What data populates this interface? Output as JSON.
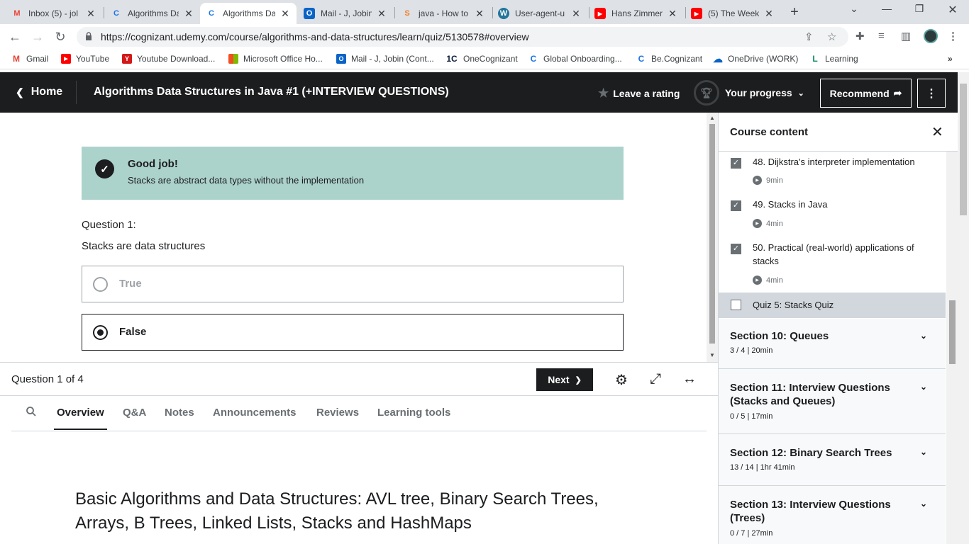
{
  "browser": {
    "tabs": [
      {
        "title": "Inbox (5) - jol",
        "icon": "gmail-icon",
        "color": "#ea4335",
        "glyph": "M"
      },
      {
        "title": "Algorithms Da",
        "icon": "cognizant-icon",
        "color": "#1a73e8",
        "glyph": "C"
      },
      {
        "title": "Algorithms Da",
        "icon": "cognizant-icon",
        "color": "#1a73e8",
        "glyph": "C"
      },
      {
        "title": "Mail - J, Jobin",
        "icon": "outlook-icon",
        "color": "#0a64c8",
        "glyph": "O"
      },
      {
        "title": "java - How to",
        "icon": "stackoverflow-icon",
        "color": "#f48024",
        "glyph": "S"
      },
      {
        "title": "User-agent-u",
        "icon": "wordpress-icon",
        "color": "#21759b",
        "glyph": "W"
      },
      {
        "title": "Hans Zimmer",
        "icon": "youtube-icon",
        "color": "#ff0000",
        "glyph": "▶"
      },
      {
        "title": "(5) The Week",
        "icon": "youtube-icon",
        "color": "#ff0000",
        "glyph": "▶"
      }
    ],
    "url": "https://cognizant.udemy.com/course/algorithms-and-data-structures/learn/quiz/5130578#overview",
    "bookmarks": [
      {
        "label": "Gmail",
        "color": "#ea4335",
        "glyph": "M"
      },
      {
        "label": "YouTube",
        "color": "#ff0000",
        "glyph": "▶"
      },
      {
        "label": "Youtube Download...",
        "color": "#d21919",
        "glyph": "Y"
      },
      {
        "label": "Microsoft Office Ho...",
        "color": "#f25022",
        "glyph": "■"
      },
      {
        "label": "Mail - J, Jobin (Cont...",
        "color": "#0a64c8",
        "glyph": "O"
      },
      {
        "label": "OneCognizant",
        "color": "#0b1c3c",
        "glyph": "1C"
      },
      {
        "label": "Global Onboarding...",
        "color": "#1a73e8",
        "glyph": "C"
      },
      {
        "label": "Be.Cognizant",
        "color": "#1a73e8",
        "glyph": "C"
      },
      {
        "label": "OneDrive (WORK)",
        "color": "#0a64c8",
        "glyph": "☁"
      },
      {
        "label": "Learning",
        "color": "#0b8c5a",
        "glyph": "L"
      }
    ]
  },
  "header": {
    "home": "Home",
    "course_title": "Algorithms Data Structures in Java #1 (+INTERVIEW QUESTIONS)",
    "rating": "Leave a rating",
    "progress": "Your progress",
    "recommend": "Recommend"
  },
  "quiz": {
    "alert_title": "Good job!",
    "alert_body": "Stacks are abstract data types without the implementation",
    "question_number": "Question 1:",
    "question_text": "Stacks are data structures",
    "options": [
      {
        "label": "True",
        "selected": false
      },
      {
        "label": "False",
        "selected": true
      }
    ],
    "counter": "Question 1 of 4",
    "next": "Next"
  },
  "tabs": [
    "Overview",
    "Q&A",
    "Notes",
    "Announcements",
    "Reviews",
    "Learning tools"
  ],
  "overview_title": "Basic Algorithms and Data Structures: AVL tree, Binary Search Trees, Arrays, B Trees, Linked Lists, Stacks and HashMaps",
  "sidebar": {
    "title": "Course content",
    "lectures": [
      {
        "title": "48. Dijkstra's interpreter implementation",
        "duration": "9min",
        "done": true
      },
      {
        "title": "49. Stacks in Java",
        "duration": "4min",
        "done": true
      },
      {
        "title": "50. Practical (real-world) applications of stacks",
        "duration": "4min",
        "done": true
      },
      {
        "title": "Quiz 5: Stacks Quiz",
        "duration": "",
        "done": false
      }
    ],
    "sections": [
      {
        "title": "Section 10: Queues",
        "meta": "3 / 4 | 20min"
      },
      {
        "title": "Section 11: Interview Questions (Stacks and Queues)",
        "meta": "0 / 5 | 17min"
      },
      {
        "title": "Section 12: Binary Search Trees",
        "meta": "13 / 14 | 1hr 41min"
      },
      {
        "title": "Section 13: Interview Questions (Trees)",
        "meta": "0 / 7 | 27min"
      }
    ]
  }
}
